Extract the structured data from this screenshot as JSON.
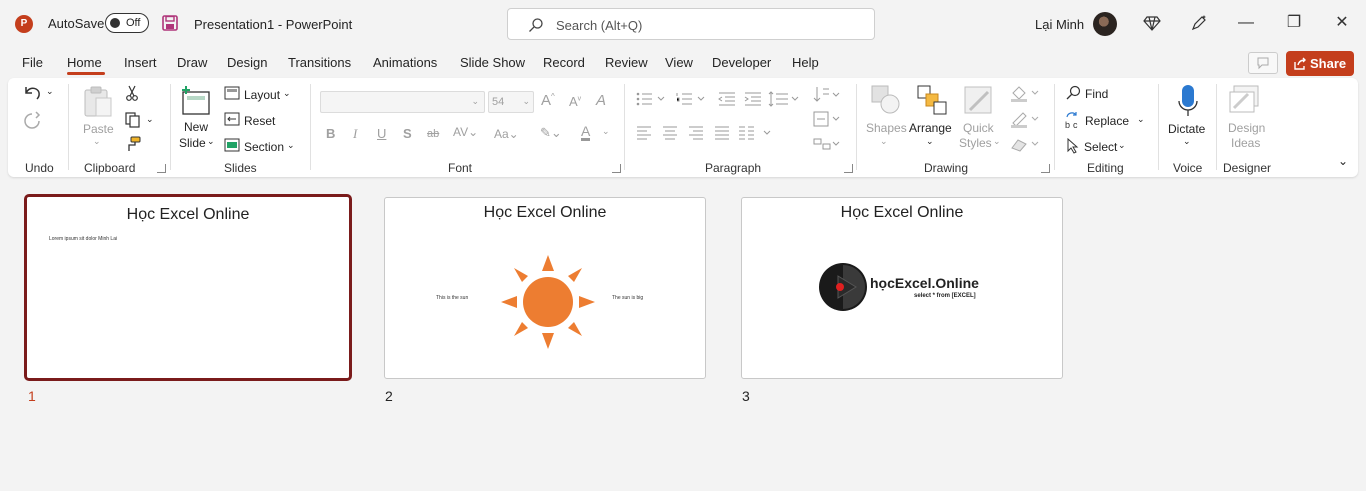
{
  "titlebar": {
    "autosave_label": "AutoSave",
    "autosave_state": "Off",
    "doc_title": "Presentation1  -  PowerPoint",
    "search_placeholder": "Search (Alt+Q)",
    "user_name": "Lại Minh",
    "brand_color": "#c43e1c"
  },
  "menu": {
    "tabs": [
      "File",
      "Home",
      "Insert",
      "Draw",
      "Design",
      "Transitions",
      "Animations",
      "Slide Show",
      "Record",
      "Review",
      "View",
      "Developer",
      "Help"
    ],
    "active_tab": "Home",
    "share_label": "Share"
  },
  "ribbon": {
    "groups": {
      "undo": "Undo",
      "clipboard": "Clipboard",
      "slides": "Slides",
      "font": "Font",
      "paragraph": "Paragraph",
      "drawing": "Drawing",
      "editing": "Editing",
      "voice": "Voice",
      "designer": "Designer"
    },
    "paste_label": "Paste",
    "new_slide_line1": "New",
    "new_slide_line2": "Slide",
    "layout_label": "Layout",
    "reset_label": "Reset",
    "section_label": "Section",
    "font_size": "54",
    "shapes_label": "Shapes",
    "arrange_label": "Arrange",
    "quick_styles_line1": "Quick",
    "quick_styles_line2": "Styles",
    "find_label": "Find",
    "replace_label": "Replace",
    "select_label": "Select",
    "dictate_label": "Dictate",
    "design_ideas_line1": "Design",
    "design_ideas_line2": "Ideas"
  },
  "slides": [
    {
      "number": "1",
      "title": "Học Excel Online",
      "body": "Lorem ipsum sit dolor Minh Lai",
      "selected": true
    },
    {
      "number": "2",
      "title": "Học Excel Online",
      "left_text": "This is the sun",
      "right_text": "The sun is big",
      "sun_color": "#ed7d31"
    },
    {
      "number": "3",
      "title": "Học Excel Online",
      "logo_main": "họcExcel.Online",
      "logo_sub": "select * from [EXCEL]"
    }
  ]
}
